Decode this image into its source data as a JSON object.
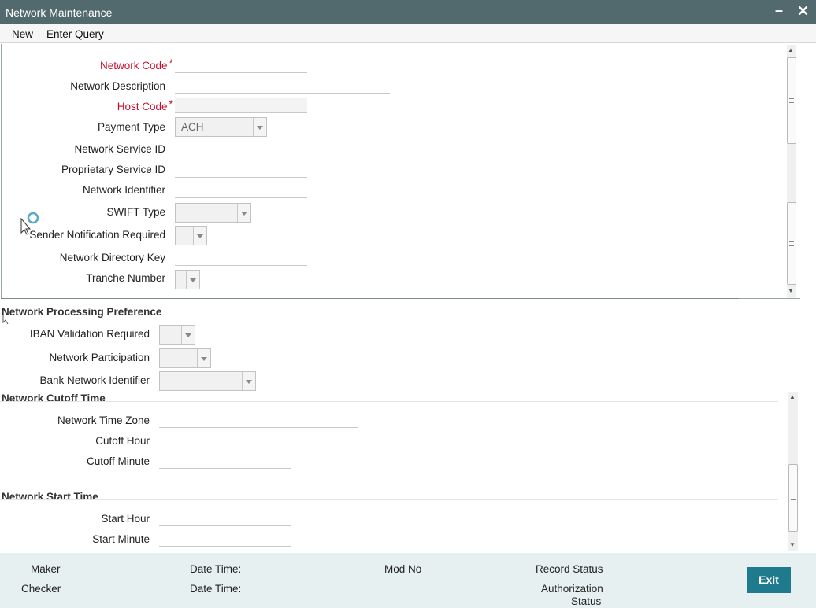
{
  "window": {
    "title": "Network Maintenance",
    "minimize_glyph": "–",
    "close_glyph": "✕"
  },
  "menu": {
    "new": "New",
    "enter_query": "Enter Query"
  },
  "form": {
    "network_code": "Network Code",
    "network_description": "Network Description",
    "host_code": "Host Code",
    "required_mark": "*",
    "payment_type": "Payment Type",
    "payment_type_value": "ACH",
    "network_service_id": "Network Service ID",
    "proprietary_service_id": "Proprietary Service ID",
    "network_identifier": "Network Identifier",
    "swift_type": "SWIFT Type",
    "sender_notification_required": "Sender Notification Required",
    "network_directory_key": "Network Directory Key",
    "tranche_number": "Tranche Number"
  },
  "processing": {
    "title": "Network Processing Preference",
    "iban_validation_required": "IBAN Validation Required",
    "network_participation": "Network Participation",
    "bank_network_identifier": "Bank Network Identifier"
  },
  "cutoff": {
    "title": "Network Cutoff Time",
    "network_time_zone": "Network Time Zone",
    "cutoff_hour": "Cutoff Hour",
    "cutoff_minute": "Cutoff Minute"
  },
  "start": {
    "title": "Network Start Time",
    "start_hour": "Start Hour",
    "start_minute": "Start Minute"
  },
  "footer": {
    "maker": "Maker",
    "checker": "Checker",
    "date_time_1": "Date Time:",
    "date_time_2": "Date Time:",
    "mod_no": "Mod No",
    "record_status": "Record Status",
    "authorization": "Authorization",
    "status": "Status",
    "exit": "Exit"
  },
  "icons": {
    "scroll_up": "▲",
    "scroll_down": "▼",
    "cursor": "busy-cursor-icon"
  },
  "colors": {
    "titlebar": "#526a6e",
    "required": "#c8102e",
    "exit_button": "#1e7a8c",
    "footer": "#e6f0f0"
  }
}
